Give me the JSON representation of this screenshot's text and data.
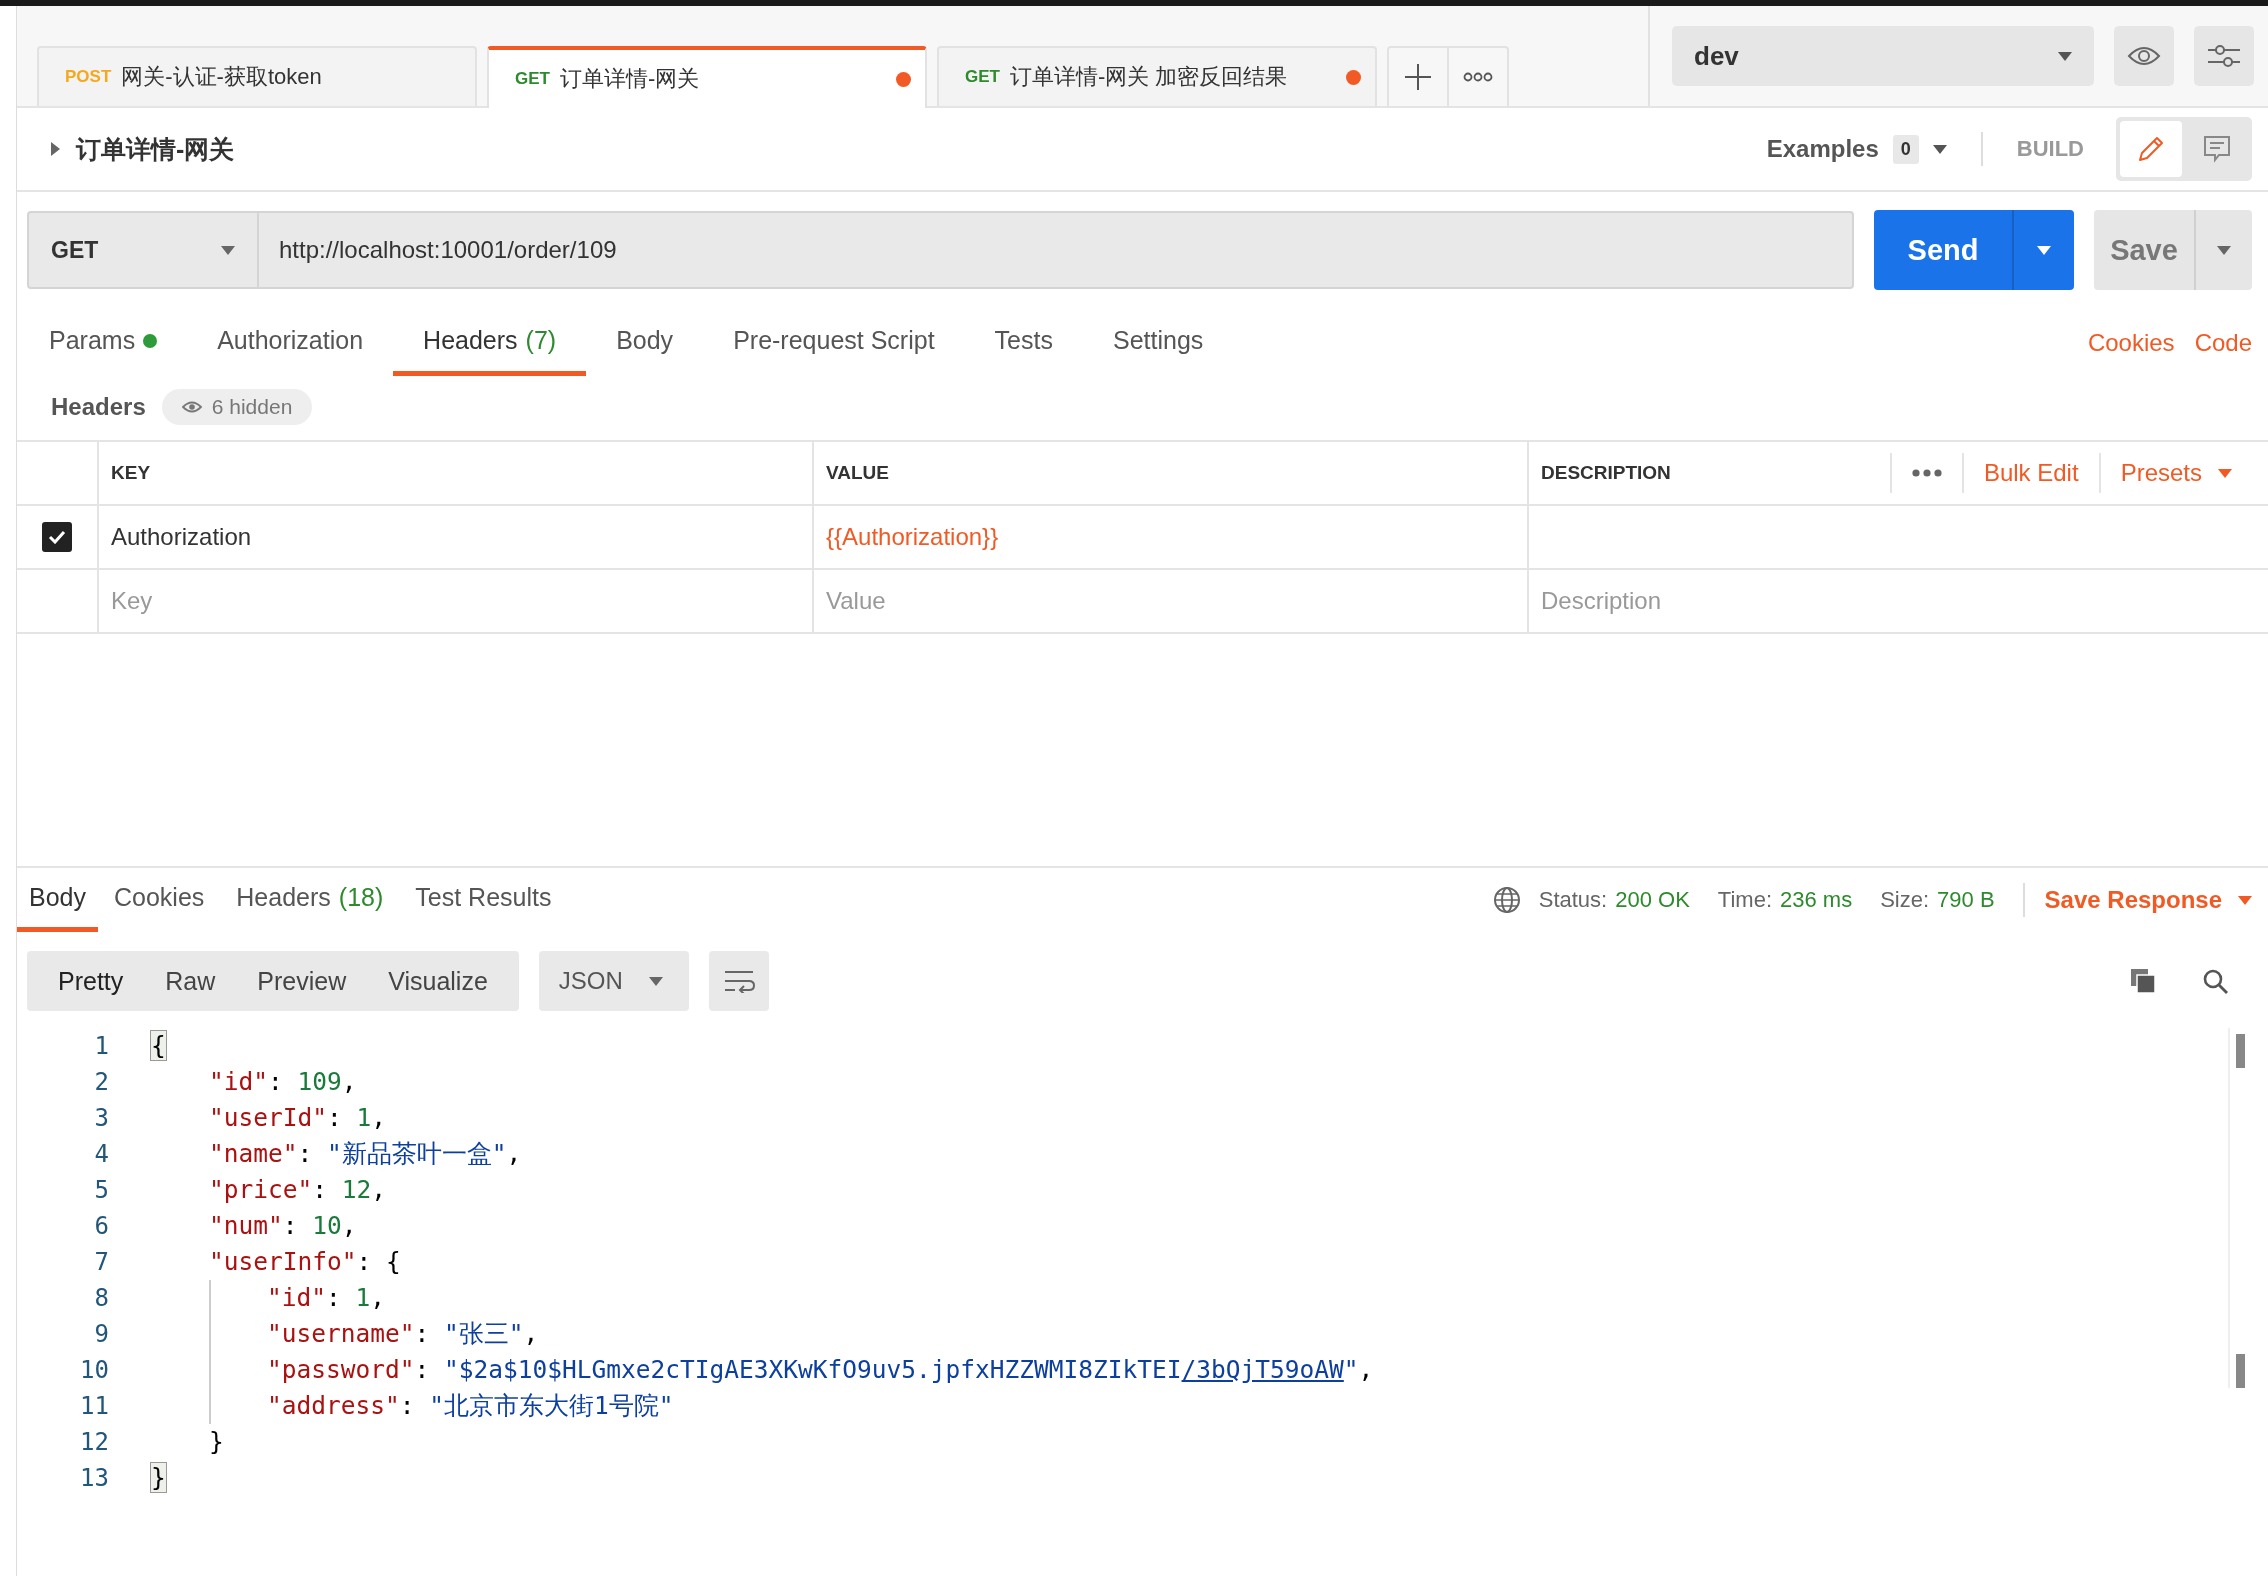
{
  "tabs": [
    {
      "method": "POST",
      "title": "网关-认证-获取token",
      "selected": false,
      "unsaved": false
    },
    {
      "method": "GET",
      "title": "订单详情-网关",
      "selected": true,
      "unsaved": true
    },
    {
      "method": "GET",
      "title": "订单详情-网关 加密反回结果",
      "selected": false,
      "unsaved": true
    }
  ],
  "environment": {
    "value": "dev"
  },
  "request": {
    "title": "订单详情-网关",
    "examples_label": "Examples",
    "examples_count": "0",
    "mode": "BUILD",
    "mode_buttons": [
      {
        "kind": "edit",
        "selected": true
      },
      {
        "kind": "comments",
        "selected": false
      }
    ]
  },
  "url_bar": {
    "method": "GET",
    "url": "http://localhost:10001/order/109",
    "send": "Send",
    "save": "Save"
  },
  "request_tabs": [
    {
      "label": "Params",
      "has_data": true,
      "selected": false
    },
    {
      "label": "Authorization",
      "has_data": false,
      "selected": false
    },
    {
      "label": "Headers",
      "count": "(7)",
      "has_data": false,
      "selected": true
    },
    {
      "label": "Body",
      "has_data": false,
      "selected": false
    },
    {
      "label": "Pre-request Script",
      "has_data": false,
      "selected": false
    },
    {
      "label": "Tests",
      "has_data": false,
      "selected": false
    },
    {
      "label": "Settings",
      "has_data": false,
      "selected": false
    }
  ],
  "request_links": [
    "Cookies",
    "Code"
  ],
  "headers_section": {
    "title": "Headers",
    "hidden": "6 hidden"
  },
  "table": {
    "columns": [
      "KEY",
      "VALUE",
      "DESCRIPTION"
    ],
    "bulk_edit": "Bulk Edit",
    "presets": "Presets",
    "rows": [
      {
        "checked": true,
        "key": "Authorization",
        "value": "{{Authorization}}",
        "value_is_variable": true
      }
    ],
    "new_row": {
      "key": {
        "placeholder": "Key"
      },
      "value": {
        "placeholder": "Value"
      },
      "description": {
        "placeholder": "Description"
      }
    }
  },
  "response": {
    "tabs": [
      {
        "label": "Body",
        "selected": true
      },
      {
        "label": "Cookies",
        "selected": false
      },
      {
        "label": "Headers",
        "count": "(18)",
        "selected": false
      },
      {
        "label": "Test Results",
        "selected": false
      }
    ],
    "status_label": "Status:",
    "status": "200 OK",
    "time_label": "Time:",
    "time": "236 ms",
    "size_label": "Size:",
    "size": "790 B",
    "save": "Save Response",
    "view_modes": [
      {
        "label": "Pretty",
        "selected": true
      },
      {
        "label": "Raw",
        "selected": false
      },
      {
        "label": "Preview",
        "selected": false
      },
      {
        "label": "Visualize",
        "selected": false
      }
    ],
    "format": "JSON",
    "lines": [
      {
        "number": "1",
        "tokens": [
          {
            "kind": "bracket",
            "text": "{"
          }
        ],
        "children": [
          {
            "number": "2",
            "tokens": [
              {
                "kind": "key",
                "text": "\"id\""
              },
              {
                "kind": "punct",
                "text": ": "
              },
              {
                "kind": "num",
                "text": "109"
              },
              {
                "kind": "punct",
                "text": ","
              }
            ]
          },
          {
            "number": "3",
            "tokens": [
              {
                "kind": "key",
                "text": "\"userId\""
              },
              {
                "kind": "punct",
                "text": ": "
              },
              {
                "kind": "num",
                "text": "1"
              },
              {
                "kind": "punct",
                "text": ","
              }
            ]
          },
          {
            "number": "4",
            "tokens": [
              {
                "kind": "key",
                "text": "\"name\""
              },
              {
                "kind": "punct",
                "text": ": "
              },
              {
                "kind": "str",
                "text": "\"新品茶叶一盒\""
              },
              {
                "kind": "punct",
                "text": ","
              }
            ]
          },
          {
            "number": "5",
            "tokens": [
              {
                "kind": "key",
                "text": "\"price\""
              },
              {
                "kind": "punct",
                "text": ": "
              },
              {
                "kind": "num",
                "text": "12"
              },
              {
                "kind": "punct",
                "text": ","
              }
            ]
          },
          {
            "number": "6",
            "tokens": [
              {
                "kind": "key",
                "text": "\"num\""
              },
              {
                "kind": "punct",
                "text": ": "
              },
              {
                "kind": "num",
                "text": "10"
              },
              {
                "kind": "punct",
                "text": ","
              }
            ]
          },
          {
            "number": "7",
            "tokens": [
              {
                "kind": "key",
                "text": "\"userInfo\""
              },
              {
                "kind": "punct",
                "text": ": {"
              }
            ],
            "children": [
              {
                "number": "8",
                "tokens": [
                  {
                    "kind": "key",
                    "text": "\"id\""
                  },
                  {
                    "kind": "punct",
                    "text": ": "
                  },
                  {
                    "kind": "num",
                    "text": "1"
                  },
                  {
                    "kind": "punct",
                    "text": ","
                  }
                ]
              },
              {
                "number": "9",
                "tokens": [
                  {
                    "kind": "key",
                    "text": "\"username\""
                  },
                  {
                    "kind": "punct",
                    "text": ": "
                  },
                  {
                    "kind": "str",
                    "text": "\"张三\""
                  },
                  {
                    "kind": "punct",
                    "text": ","
                  }
                ]
              },
              {
                "number": "10",
                "tokens": [
                  {
                    "kind": "key",
                    "text": "\"password\""
                  },
                  {
                    "kind": "punct",
                    "text": ": "
                  },
                  {
                    "kind": "str",
                    "text": "\"$2a$10$HLGmxe2cTIgAE3XKwKfO9uv5.jpfxHZZWMI8ZIkTEI"
                  },
                  {
                    "kind": "link",
                    "text": "/3bQjT59oAW"
                  },
                  {
                    "kind": "str",
                    "text": "\""
                  },
                  {
                    "kind": "punct",
                    "text": ","
                  }
                ]
              },
              {
                "number": "11",
                "tokens": [
                  {
                    "kind": "key",
                    "text": "\"address\""
                  },
                  {
                    "kind": "punct",
                    "text": ": "
                  },
                  {
                    "kind": "str",
                    "text": "\"北京市东大街1号院\""
                  }
                ]
              }
            ]
          },
          {
            "number": "12",
            "tokens": [
              {
                "kind": "punct",
                "text": "}"
              }
            ]
          }
        ]
      },
      {
        "number": "13",
        "tokens": [
          {
            "kind": "bracket",
            "text": "}"
          }
        ]
      }
    ]
  }
}
